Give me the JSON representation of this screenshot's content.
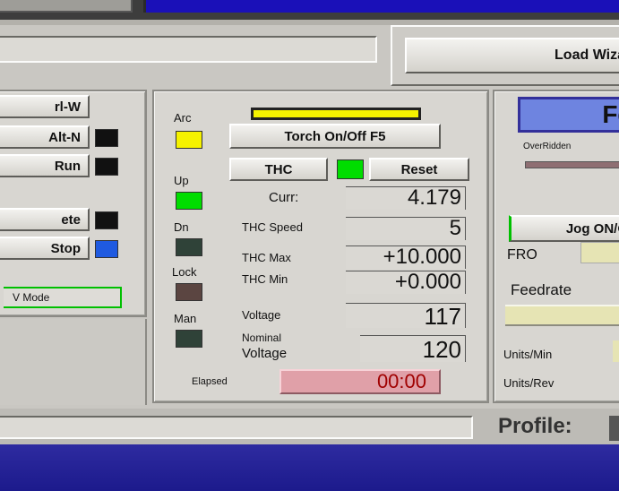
{
  "toolbar": {
    "load_wizard_label": "Load Wiza"
  },
  "left_panel": {
    "buttons": [
      "rl-W",
      "Alt-N",
      "Run",
      "ete",
      "Stop"
    ],
    "v_mode_label": "V Mode"
  },
  "thc_panel": {
    "arc_label": "Arc",
    "torch_button": "Torch On/Off F5",
    "thc_button": "THC",
    "reset_button": "Reset",
    "up_label": "Up",
    "dn_label": "Dn",
    "lock_label": "Lock",
    "man_label": "Man",
    "curr_label": "Curr:",
    "curr_value": "4.179",
    "thc_speed_label": "THC Speed",
    "thc_speed_value": "5",
    "thc_max_label": "THC Max",
    "thc_max_value": "+10.000",
    "thc_min_label": "THC Min",
    "thc_min_value": "+0.000",
    "voltage_label": "Voltage",
    "voltage_value": "117",
    "nominal_label_1": "Nominal",
    "nominal_label_2": "Voltage",
    "nominal_value": "120",
    "elapsed_label": "Elapsed",
    "elapsed_value": "00:00"
  },
  "right_panel": {
    "feed_title": "Fe",
    "overridden_label": "OverRidden",
    "jog_button": "Jog ON/Of",
    "fro_label": "FRO",
    "feedrate_label": "Feedrate",
    "units_min_label": "Units/Min",
    "units_rev_label": "Units/Rev"
  },
  "status": {
    "profile_label": "Profile:"
  },
  "colors": {
    "yellow": "#f5f200",
    "green": "#00dd00",
    "dark_led": "#2f4238",
    "lock_led": "#5b4541",
    "blue_led": "#1f5ae0"
  }
}
